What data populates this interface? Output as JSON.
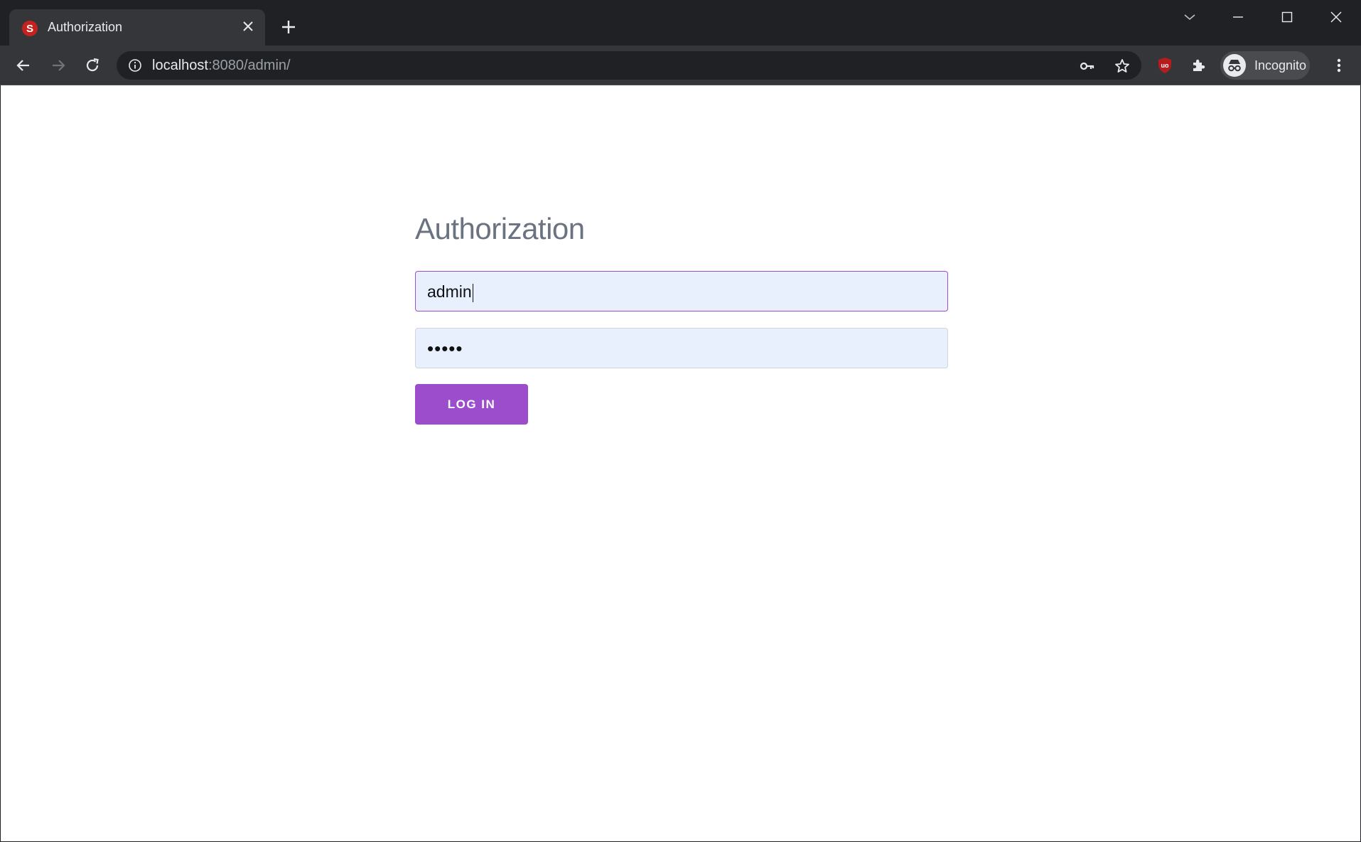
{
  "browser": {
    "tab": {
      "title": "Authorization",
      "favicon_letter": "S"
    },
    "address_bar": {
      "host": "localhost",
      "rest": ":8080/admin/"
    },
    "profile": {
      "label": "Incognito"
    }
  },
  "page": {
    "title": "Authorization",
    "username": {
      "value": "admin"
    },
    "password": {
      "masked_value": "•••••"
    },
    "login_button": {
      "label": "LOG IN"
    }
  },
  "colors": {
    "accent": "#9c4dcc",
    "field_background": "#e8f0fe",
    "chrome_dark": "#202124",
    "toolbar": "#35363a"
  }
}
